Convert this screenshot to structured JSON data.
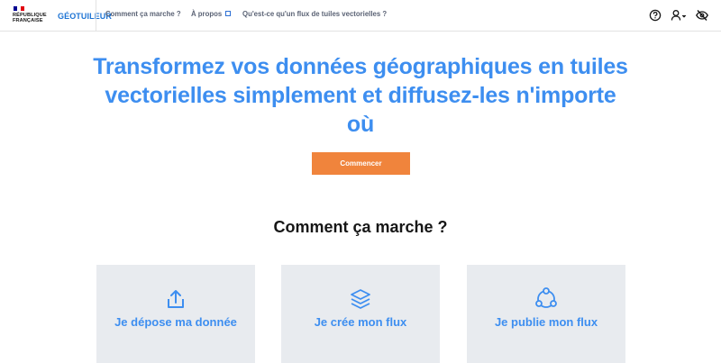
{
  "header": {
    "republic_line1": "RÉPUBLIQUE",
    "republic_line2": "FRANÇAISE",
    "site_name": "GÉOTUILEUR",
    "nav": [
      {
        "label": "Comment ça marche ?"
      },
      {
        "label": "À propos"
      },
      {
        "label": "Qu'est-ce qu'un flux de tuiles vectorielles ?"
      }
    ],
    "icons": [
      "help-icon",
      "user-icon",
      "eye-off-icon"
    ]
  },
  "hero": {
    "title": "Transformez vos données géographiques en tuiles vectorielles simplement et diffusez-les n'importe où",
    "button_label": "Commencer"
  },
  "how_it_works": {
    "title": "Comment ça marche ?",
    "cards": [
      {
        "label": "Je dépose ma donnée",
        "icon": "upload-icon"
      },
      {
        "label": "Je crée mon flux",
        "icon": "layers-icon"
      },
      {
        "label": "Je publie mon flux",
        "icon": "share-nodes-icon"
      }
    ]
  },
  "colors": {
    "accent": "#3d8ef0",
    "brand_blue": "#1e74d4",
    "button": "#f0843c",
    "card_bg": "#e8ebef"
  }
}
